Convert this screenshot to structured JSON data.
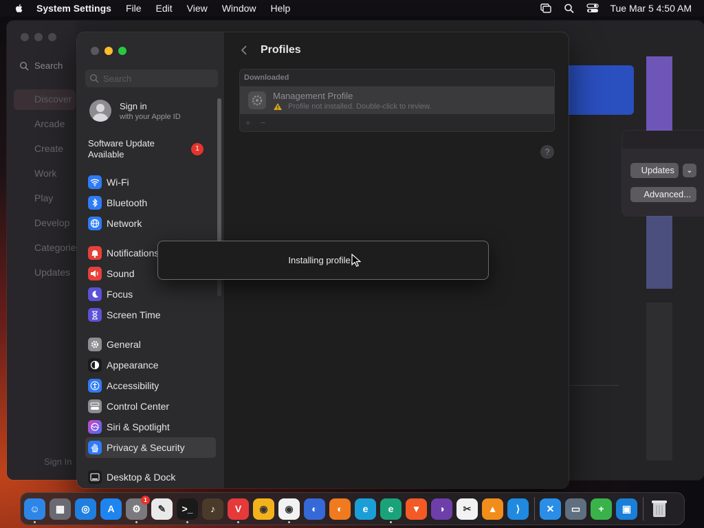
{
  "menubar": {
    "app": "System Settings",
    "items": [
      "File",
      "Edit",
      "View",
      "Window",
      "Help"
    ],
    "clock": "Tue Mar 5  4:50 AM"
  },
  "background_window": {
    "search_label": "Search",
    "nav": [
      "Discover",
      "Arcade",
      "Create",
      "Work",
      "Play",
      "Develop",
      "Categories",
      "Updates"
    ],
    "signin": "Sign In",
    "updates_button": "Updates",
    "advanced_button": "Advanced..."
  },
  "sidebar": {
    "search_placeholder": "Search",
    "account_name": "Sign in",
    "account_sub": "with your Apple ID",
    "software_update": "Software Update Available",
    "update_badge": "1",
    "group1": [
      {
        "label": "Wi-Fi",
        "icon": "wifi-icon",
        "color": "#2f7bf5"
      },
      {
        "label": "Bluetooth",
        "icon": "bluetooth-icon",
        "color": "#2f7bf5"
      },
      {
        "label": "Network",
        "icon": "globe-icon",
        "color": "#2f7bf5"
      }
    ],
    "group2": [
      {
        "label": "Notifications",
        "icon": "bell-icon",
        "color": "#e5413a"
      },
      {
        "label": "Sound",
        "icon": "speaker-icon",
        "color": "#e5413a"
      },
      {
        "label": "Focus",
        "icon": "moon-icon",
        "color": "#5b52d6"
      },
      {
        "label": "Screen Time",
        "icon": "hourglass-icon",
        "color": "#5b52d6"
      }
    ],
    "group3": [
      {
        "label": "General",
        "icon": "gear-icon",
        "color": "#8e8d91"
      },
      {
        "label": "Appearance",
        "icon": "appearance-icon",
        "color": "#1c1c1c"
      },
      {
        "label": "Accessibility",
        "icon": "accessibility-icon",
        "color": "#2f7bf5"
      },
      {
        "label": "Control Center",
        "icon": "control-center-icon",
        "color": "#8e8d91"
      },
      {
        "label": "Siri & Spotlight",
        "icon": "siri-icon",
        "color": "#b249d8"
      },
      {
        "label": "Privacy & Security",
        "icon": "hand-icon",
        "color": "#2f7bf5"
      }
    ],
    "group4": [
      {
        "label": "Desktop & Dock",
        "icon": "dock-icon",
        "color": "#1c1c1c"
      }
    ]
  },
  "content": {
    "title": "Profiles",
    "section_header": "Downloaded",
    "profile_name": "Management Profile",
    "profile_status": "Profile not installed. Double-click to review.",
    "add_label": "+",
    "remove_label": "−",
    "help_label": "?"
  },
  "dialog": {
    "message": "Installing profile..."
  },
  "dock": {
    "badge": "1",
    "apps": [
      {
        "name": "finder",
        "color": "#2c86e8",
        "glyph": "☺"
      },
      {
        "name": "launchpad",
        "color": "#6a6a72",
        "glyph": "▦"
      },
      {
        "name": "safari",
        "color": "#1f7fe0",
        "glyph": "◎"
      },
      {
        "name": "app-store",
        "color": "#1d84f0",
        "glyph": "A"
      },
      {
        "name": "system-settings",
        "color": "#7a797d",
        "glyph": "⚙"
      },
      {
        "name": "textedit",
        "color": "#e9e9e9",
        "glyph": "✎"
      },
      {
        "name": "terminal",
        "color": "#1a1a1a",
        "glyph": ">_"
      },
      {
        "name": "garageband",
        "color": "#4a3a2a",
        "glyph": "♪"
      },
      {
        "name": "vivaldi",
        "color": "#e5393a",
        "glyph": "V"
      },
      {
        "name": "chromium",
        "color": "#f3b21b",
        "glyph": "◉"
      },
      {
        "name": "chrome",
        "color": "#f2f2f2",
        "glyph": "◉"
      },
      {
        "name": "firefox-dev",
        "color": "#3569d8",
        "glyph": "◐"
      },
      {
        "name": "firefox",
        "color": "#f07a1f",
        "glyph": "◐"
      },
      {
        "name": "edge",
        "color": "#1b9ed8",
        "glyph": "e"
      },
      {
        "name": "edge-canary",
        "color": "#1aa37a",
        "glyph": "e"
      },
      {
        "name": "brave",
        "color": "#f25a26",
        "glyph": "▼"
      },
      {
        "name": "tor",
        "color": "#6e3fa8",
        "glyph": "◑"
      },
      {
        "name": "capcut",
        "color": "#f2f2f2",
        "glyph": "✂"
      },
      {
        "name": "vlc",
        "color": "#f28c1a",
        "glyph": "▲"
      },
      {
        "name": "vscode",
        "color": "#1f8ae0",
        "glyph": "⟩"
      }
    ],
    "extras": [
      {
        "name": "xcode-tools",
        "color": "#2a8ee8",
        "glyph": "✕"
      },
      {
        "name": "installer",
        "color": "#5f6f7f",
        "glyph": "▭"
      },
      {
        "name": "plus-app",
        "color": "#3ab24a",
        "glyph": "+"
      },
      {
        "name": "remote-desktop",
        "color": "#1a7fd8",
        "glyph": "▣"
      }
    ]
  }
}
